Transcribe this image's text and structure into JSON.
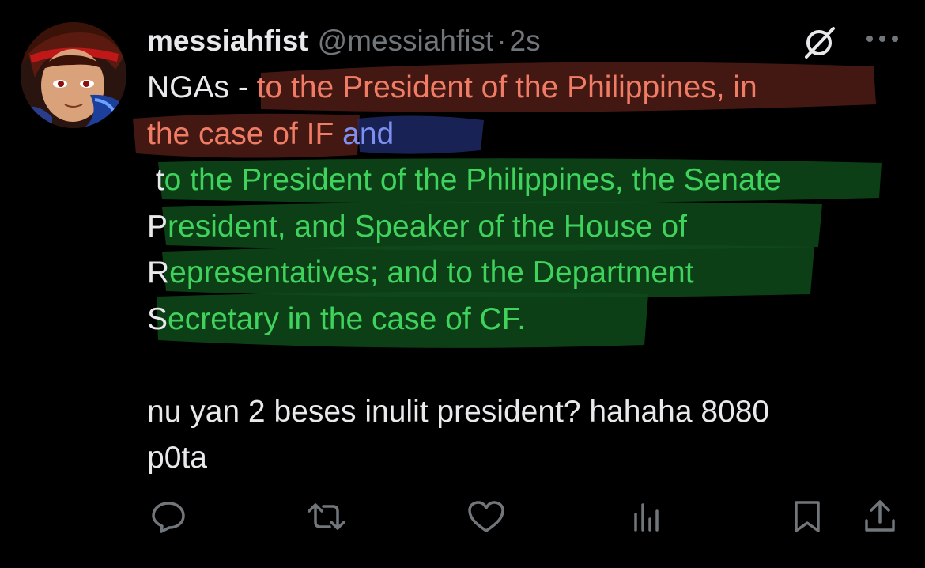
{
  "tweet": {
    "display_name": "messiahfist",
    "handle": "@messiahfist",
    "separator": "·",
    "time": "2s",
    "body": {
      "line1_prefix": "NGAs - ",
      "line1_red": "to the President of the Philippines, in",
      "line2_red": "the case of IF",
      "line2_blue": "and",
      "line3_white": " t",
      "line3_green": "o the President of the Philippines, the Senate",
      "line4_white": "P",
      "line4_green": "resident, and Speaker of the House of",
      "line5_white": "R",
      "line5_green": "epresentatives; and to the Department",
      "line6_white": "S",
      "line6_green": "ecretary in the case of CF.",
      "line7": "nu yan 2 beses inulit president? hahaha 8080",
      "line8": "p0ta"
    }
  },
  "icons": {
    "grok": "grok-slash-circle-icon",
    "more": "more-dots-icon",
    "reply": "reply-bubble-icon",
    "retweet": "retweet-icon",
    "like": "heart-icon",
    "views": "views-bars-icon",
    "bookmark": "bookmark-icon",
    "share": "share-upload-icon"
  },
  "colors": {
    "background": "#000000",
    "text": "#e7e9ea",
    "muted": "#71767b",
    "red_highlight": "#f07c66",
    "blue_highlight": "#7d8ff0",
    "green_highlight": "#3fd35e"
  }
}
